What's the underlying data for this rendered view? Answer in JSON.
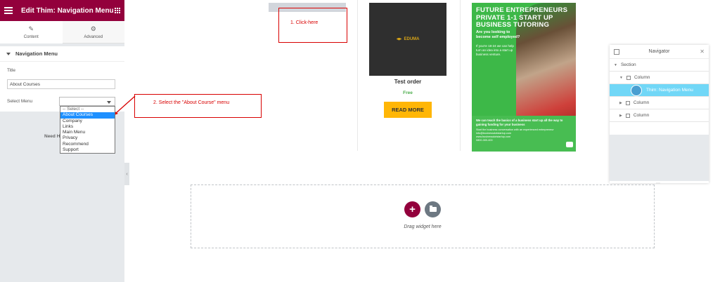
{
  "panel": {
    "header_title": "Edit Thim: Navigation Menu",
    "tabs": [
      {
        "label": "Content",
        "icon": "pencil-icon"
      },
      {
        "label": "Advanced",
        "icon": "gear-icon"
      }
    ],
    "section_title": "Navigation Menu",
    "title_label": "Title",
    "title_value": "About Courses",
    "select_label": "Select Menu",
    "need_help": "Need H",
    "dropdown": {
      "placeholder": "-- Select --",
      "options": [
        "About Courses",
        "Company",
        "Links",
        "Main Menu",
        "Privacy",
        "Recommend",
        "Support"
      ],
      "selected": "About Courses"
    }
  },
  "course": {
    "logo_text": "EDUMA",
    "title": "Test order",
    "price": "Free",
    "button": "READ MORE"
  },
  "ad": {
    "headline_1": "FUTURE ENTREPRENEURS",
    "headline_2": "PRIVATE 1-1 START UP",
    "headline_3": "BUSINESS TUTORING",
    "sub": "Are you looking to become self employed?",
    "sub2": "If you're 18-24 we can help turn an idea into a start up business venture.",
    "bottom_1": "We can teach the basics of a business start up all the way to gaining funding for your business",
    "bottom_2": "Start the business conversation with an experienced entrepreneur",
    "bottom_3": "info@businessdotstartup.com",
    "bottom_4": "www.businessdotstartup.com",
    "bottom_5": "0800-300-400"
  },
  "annotations": {
    "click_here": "1. Click-here",
    "select_menu": "2. Select the \"About Course\" menu"
  },
  "navigator": {
    "title": "Navigator",
    "rows": [
      "Section",
      "Column",
      "Thim: Navigation Menu",
      "Column",
      "Column"
    ]
  },
  "dropzone": {
    "text": "Drag widget here"
  },
  "colors": {
    "brand": "#93003c",
    "accent_yellow": "#ffb606",
    "highlight": "#71d7f7",
    "annotation": "#d80000"
  }
}
